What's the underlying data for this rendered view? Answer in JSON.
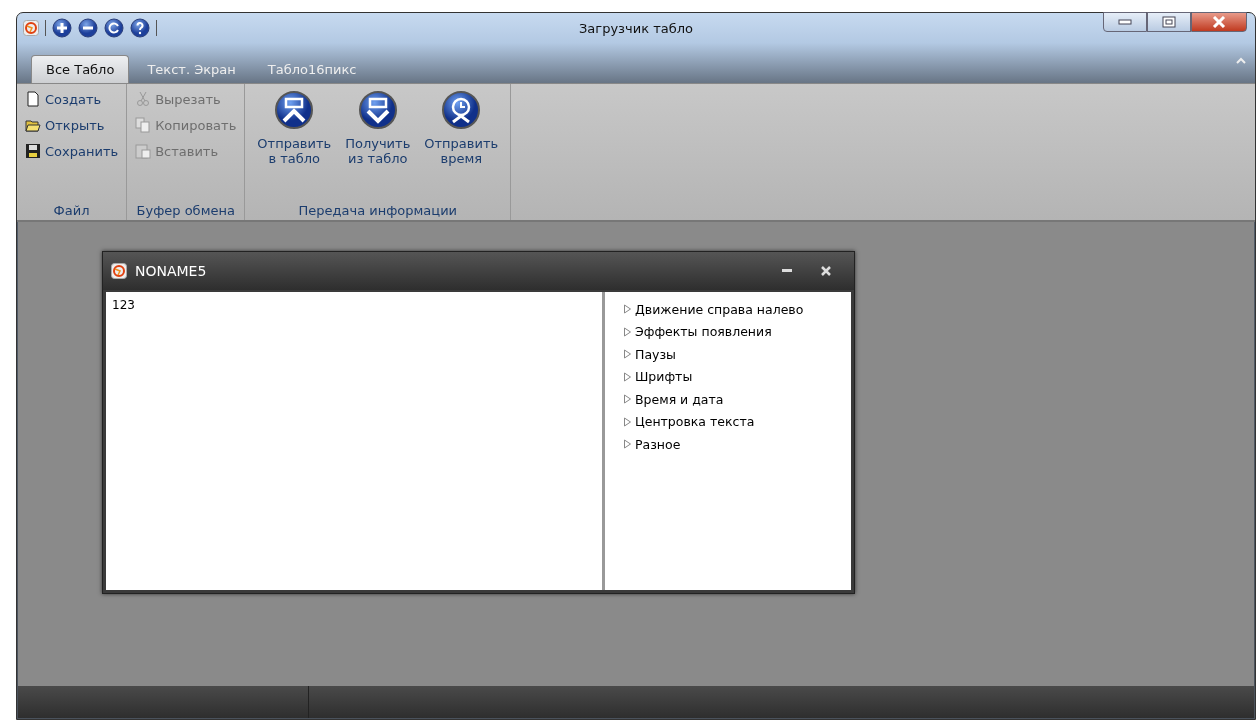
{
  "window": {
    "title": "Загрузчик табло"
  },
  "tabs": [
    {
      "label": "Все Табло",
      "selected": true
    },
    {
      "label": "Текст. Экран",
      "selected": false
    },
    {
      "label": "Табло16пикс",
      "selected": false
    }
  ],
  "ribbon_groups": [
    {
      "label": "Файл",
      "kind": "small",
      "items": [
        {
          "label": "Создать",
          "disabled": false
        },
        {
          "label": "Открыть",
          "disabled": false
        },
        {
          "label": "Сохранить",
          "disabled": false
        }
      ]
    },
    {
      "label": "Буфер обмена",
      "kind": "small",
      "items": [
        {
          "label": "Вырезать",
          "disabled": true
        },
        {
          "label": "Копировать",
          "disabled": true
        },
        {
          "label": "Вставить",
          "disabled": true
        }
      ]
    },
    {
      "label": "Передача информации",
      "kind": "large",
      "items": [
        {
          "label": "Отправить\nв табло",
          "disabled": false
        },
        {
          "label": "Получить\nиз табло",
          "disabled": false
        },
        {
          "label": "Отправить\nвремя",
          "disabled": false
        }
      ]
    }
  ],
  "document": {
    "title": "NONAME5",
    "text": "123",
    "tree": [
      {
        "label": "Движение справа налево",
        "expanded": false
      },
      {
        "label": "Эффекты появления",
        "expanded": false
      },
      {
        "label": "Паузы",
        "expanded": false
      },
      {
        "label": "Шрифты",
        "expanded": false
      },
      {
        "label": "Время и дата",
        "expanded": false
      },
      {
        "label": "Центровка текста",
        "expanded": false
      },
      {
        "label": "Разное",
        "expanded": false
      }
    ]
  }
}
